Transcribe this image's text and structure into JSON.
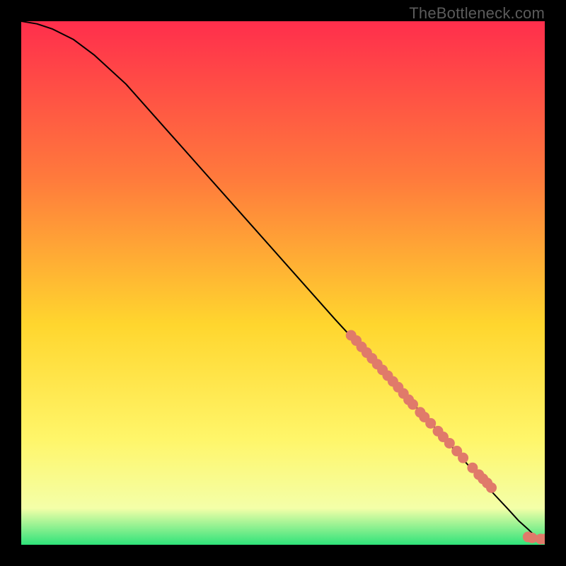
{
  "watermark": "TheBottleneck.com",
  "chart_data": {
    "type": "line",
    "title": "",
    "xlabel": "",
    "ylabel": "",
    "xlim": [
      0,
      100
    ],
    "ylim": [
      0,
      100
    ],
    "grid": false,
    "gradient_colors": {
      "top": "#ff2e4c",
      "upper_mid": "#ff7a3c",
      "mid": "#ffd62e",
      "lower_mid": "#fff66a",
      "near_bottom": "#f4ffa8",
      "bottom": "#2fe37a"
    },
    "series": [
      {
        "name": "curve",
        "type": "line",
        "stroke": "#000000",
        "x": [
          0,
          3,
          6,
          10,
          14,
          20,
          28,
          36,
          44,
          52,
          60,
          66,
          72,
          78,
          82,
          86,
          90,
          93,
          95,
          97,
          98.5,
          100
        ],
        "y": [
          100,
          99.5,
          98.5,
          96.5,
          93.5,
          88,
          79,
          70,
          61,
          52,
          43,
          36.5,
          30,
          23.5,
          19,
          14.5,
          10,
          6.8,
          4.6,
          2.8,
          1.3,
          1.1
        ]
      },
      {
        "name": "dots-on-curve",
        "type": "scatter",
        "color": "#e07a6a",
        "x": [
          63,
          64,
          65,
          66,
          67,
          68,
          69,
          70,
          71,
          72,
          73,
          74,
          74.8,
          76.2,
          77,
          78.2,
          79.6,
          80.6,
          81.8,
          83.2,
          84.4,
          86.2,
          87.4,
          88.2,
          89,
          89.8,
          96.8,
          97.6,
          99.2,
          100
        ],
        "y": [
          40,
          39,
          37.8,
          36.7,
          35.6,
          34.5,
          33.4,
          32.3,
          31.2,
          30.1,
          28.9,
          27.7,
          26.8,
          25.3,
          24.4,
          23.2,
          21.7,
          20.6,
          19.4,
          17.9,
          16.6,
          14.7,
          13.4,
          12.6,
          11.8,
          10.9,
          1.5,
          1.3,
          1.1,
          1.1
        ]
      }
    ]
  }
}
